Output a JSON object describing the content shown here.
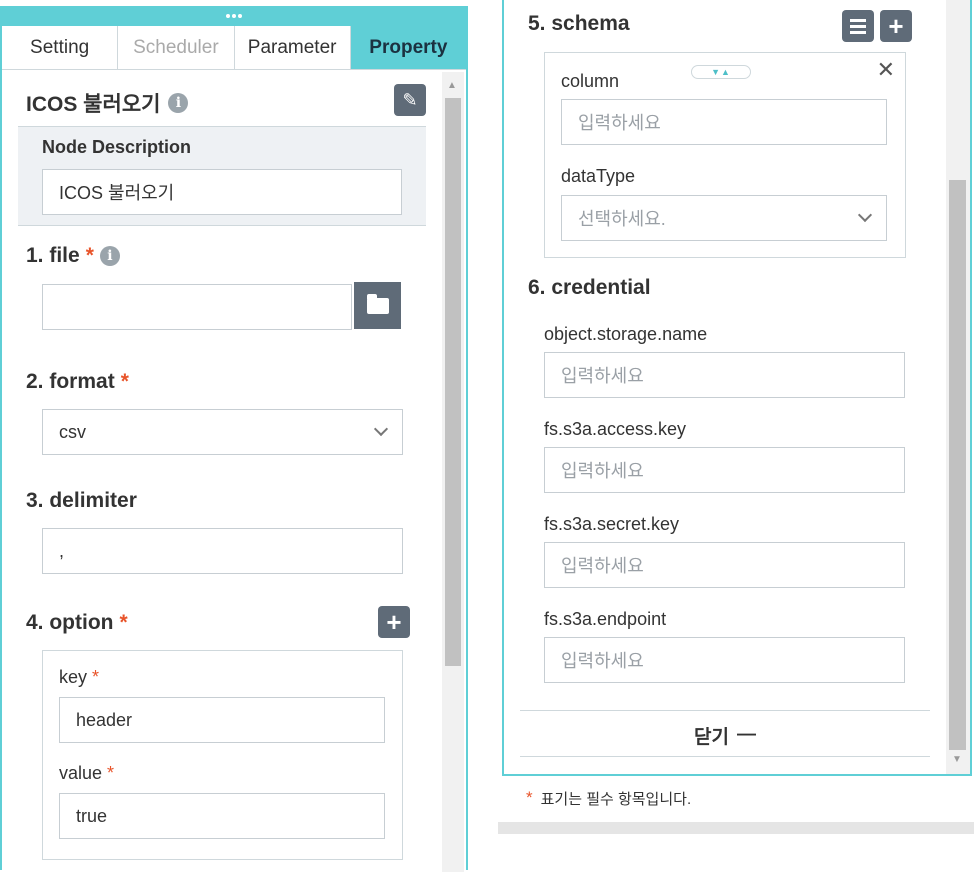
{
  "tabs": {
    "setting": "Setting",
    "scheduler": "Scheduler",
    "parameter": "Parameter",
    "property": "Property"
  },
  "node": {
    "title": "ICOS 불러오기",
    "description_label": "Node Description",
    "description_value": "ICOS 불러오기"
  },
  "sections": {
    "file": {
      "title": "1. file",
      "value": ""
    },
    "format": {
      "title": "2. format",
      "value": "csv"
    },
    "delimiter": {
      "title": "3. delimiter",
      "value": ","
    },
    "option": {
      "title": "4. option",
      "key_label": "key",
      "key_value": "header",
      "value_label": "value",
      "value_value": "true"
    },
    "schema": {
      "title": "5. schema",
      "column_label": "column",
      "column_placeholder": "입력하세요",
      "datatype_label": "dataType",
      "datatype_placeholder": "선택하세요."
    },
    "credential": {
      "title": "6. credential",
      "fields": [
        {
          "label": "object.storage.name",
          "placeholder": "입력하세요"
        },
        {
          "label": "fs.s3a.access.key",
          "placeholder": "입력하세요"
        },
        {
          "label": "fs.s3a.secret.key",
          "placeholder": "입력하세요"
        },
        {
          "label": "fs.s3a.endpoint",
          "placeholder": "입력하세요"
        }
      ]
    }
  },
  "required_mark": "*",
  "close_label": "닫기",
  "close_symbol": "—",
  "footnote": "표기는 필수 항목입니다.",
  "icons": {
    "info": "i",
    "edit": "✎",
    "plus": "+",
    "close": "✕",
    "sort": "▼▲",
    "scroll_up": "▲",
    "scroll_down": "▼"
  },
  "colors": {
    "accent": "#5fcfd6",
    "required": "#e8542a",
    "button": "#5f6b78"
  }
}
